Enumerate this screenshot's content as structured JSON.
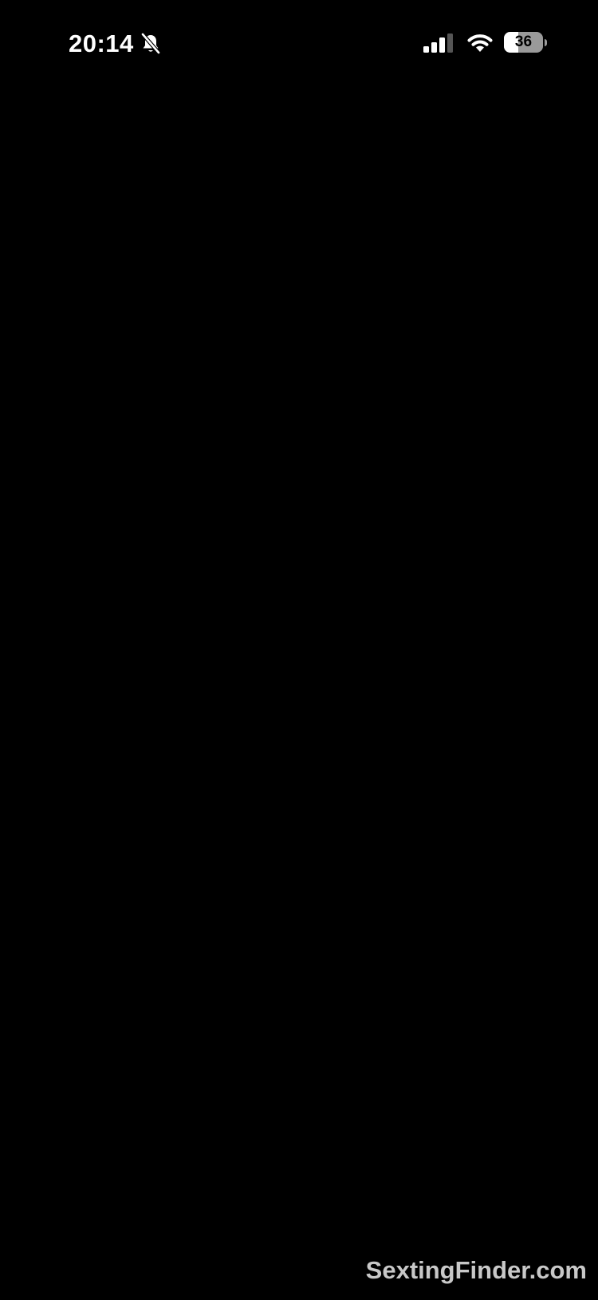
{
  "status_bar": {
    "time": "20:14",
    "silent_icon": "bell-slash-icon",
    "signal_icon": "cellular-signal-icon",
    "signal_bars_active": 3,
    "signal_bars_total": 4,
    "wifi_icon": "wifi-icon",
    "battery_icon": "battery-icon",
    "battery_level": "36",
    "battery_fraction": 0.36
  },
  "screen": {
    "background": "#000000"
  },
  "watermark": {
    "text": "SextingFinder.com",
    "color": "#c8c8c8"
  }
}
